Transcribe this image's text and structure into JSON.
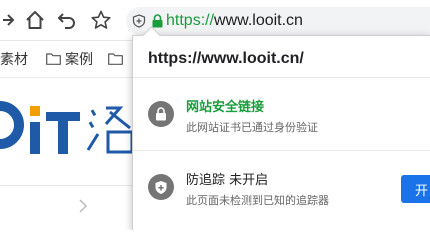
{
  "toolbar": {
    "address": {
      "scheme": "https://",
      "host": "www.looit.cn"
    }
  },
  "bookmarks": [
    {
      "label": "素材",
      "has_folder_icon": false
    },
    {
      "label": "案例",
      "has_folder_icon": true
    },
    {
      "label": "",
      "has_folder_icon": true
    }
  ],
  "page": {
    "logo_fragment": "oIT 洛"
  },
  "popup": {
    "url": "https://www.looit.cn/",
    "connection": {
      "title": "网站安全链接",
      "subtitle": "此网站证书已通过身份验证",
      "title_color": "#1a9d3c",
      "icon": "lock-icon"
    },
    "tracking": {
      "title": "防追踪 未开启",
      "subtitle": "此页面未检测到已知的追踪器",
      "icon": "shield-plus-icon",
      "button_label": "开"
    }
  },
  "colors": {
    "secure_green": "#1a9d3c",
    "logo_blue": "#1e5aa8",
    "logo_orange": "#f0a000",
    "button_blue": "#1a73e8"
  }
}
